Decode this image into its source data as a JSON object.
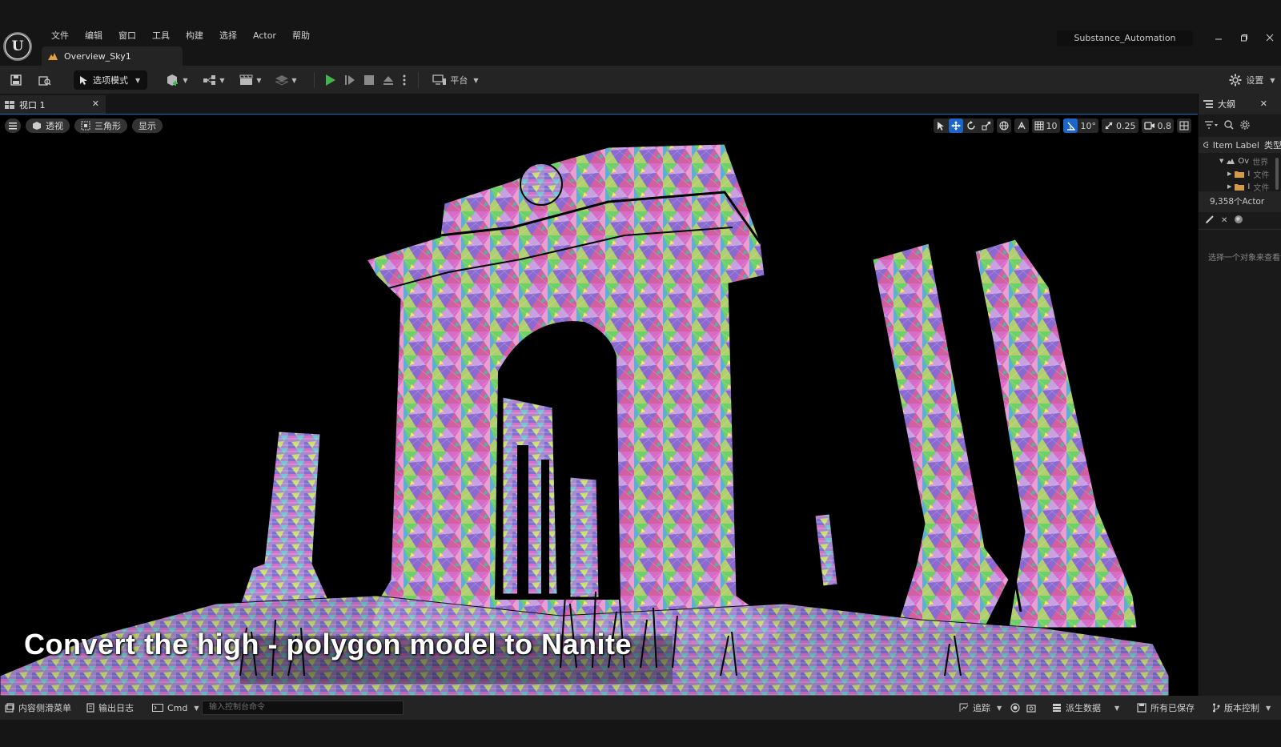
{
  "app": {
    "logo_letter": "U",
    "project_name": "Substance_Automation",
    "document_tab": "Overview_Sky1"
  },
  "menu": [
    "文件",
    "编辑",
    "窗口",
    "工具",
    "构建",
    "选择",
    "Actor",
    "帮助"
  ],
  "toolbar": {
    "mode_label": "选项模式",
    "platform_label": "平台",
    "settings_label": "设置"
  },
  "viewport": {
    "tab_label": "视口 1",
    "view_mode": "透视",
    "lit_mode": "三角形",
    "show_label": "显示",
    "grid_snap": "10",
    "rotation_snap": "10°",
    "scale_snap": "0.25",
    "camera_speed": "0.8",
    "caption": "Convert the high - polygon model to Nanite"
  },
  "outliner": {
    "title": "大纲",
    "col_label": "Item Label",
    "col_type": "类型",
    "rows": [
      {
        "label": "Ov",
        "type": "世界"
      },
      {
        "label": "I",
        "type": "文件"
      },
      {
        "label": "I",
        "type": "文件"
      }
    ],
    "actor_count": "9,358个Actor"
  },
  "details": {
    "hint": "选择一个对象来查看详细信息"
  },
  "statusbar": {
    "content_drawer": "内容侧滑菜单",
    "output_log": "输出日志",
    "cmd_label": "Cmd",
    "cmd_placeholder": "输入控制台命令",
    "trace_label": "追踪",
    "derived_data": "派生数据",
    "all_saved": "所有已保存",
    "source_control": "版本控制"
  },
  "colors": {
    "accent_blue": "#1c65c9",
    "play_green": "#3fb64a",
    "panel_bg": "#242424",
    "window_bg": "#151515"
  }
}
